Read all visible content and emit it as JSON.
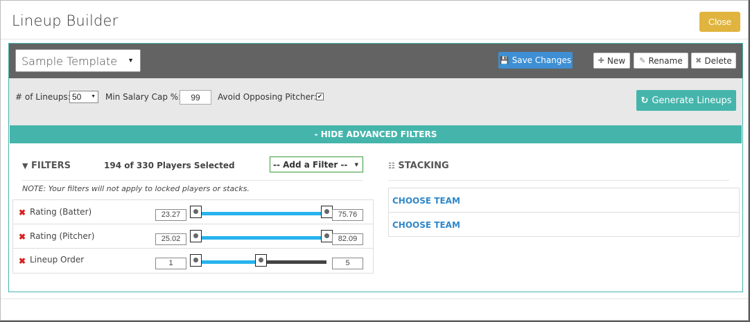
{
  "window": {
    "title": "Lineup Builder",
    "close_label": "Close"
  },
  "toolbar": {
    "template_value": "Sample Template",
    "save_label": "Save Changes",
    "new_label": "New",
    "rename_label": "Rename",
    "delete_label": "Delete"
  },
  "options": {
    "lineups_label": "# of Lineups:",
    "lineups_value": "50",
    "salary_label": "Min Salary Cap %:",
    "salary_value": "99",
    "avoid_label": "Avoid Opposing Pitcher:",
    "avoid_checked": true,
    "generate_label": "Generate Lineups"
  },
  "advanced": {
    "toggle_label": "- HIDE ADVANCED FILTERS"
  },
  "filters": {
    "heading": "FILTERS",
    "selected_count": "194 of 330 Players Selected",
    "add_filter_placeholder": "-- Add a Filter --",
    "note": "NOTE: Your filters will not apply to locked players or stacks.",
    "rows": [
      {
        "label": "Rating (Batter)",
        "min": "23.27",
        "max": "75.76",
        "low_fraction": 0.0,
        "high_fraction": 1.0
      },
      {
        "label": "Rating (Pitcher)",
        "min": "25.02",
        "max": "82.09",
        "low_fraction": 0.0,
        "high_fraction": 1.0
      },
      {
        "label": "Lineup Order",
        "min": "1",
        "max": "5",
        "low_fraction": 0.0,
        "high_fraction": 0.5
      }
    ]
  },
  "stacking": {
    "heading": "STACKING",
    "teams": [
      {
        "label": "CHOOSE TEAM"
      },
      {
        "label": "CHOOSE TEAM"
      }
    ]
  },
  "colors": {
    "accent": "#45b5ac",
    "primary": "#3e8fd4",
    "warning": "#e0b43e",
    "slider_fill": "#27b3ee",
    "danger": "#d62020"
  }
}
